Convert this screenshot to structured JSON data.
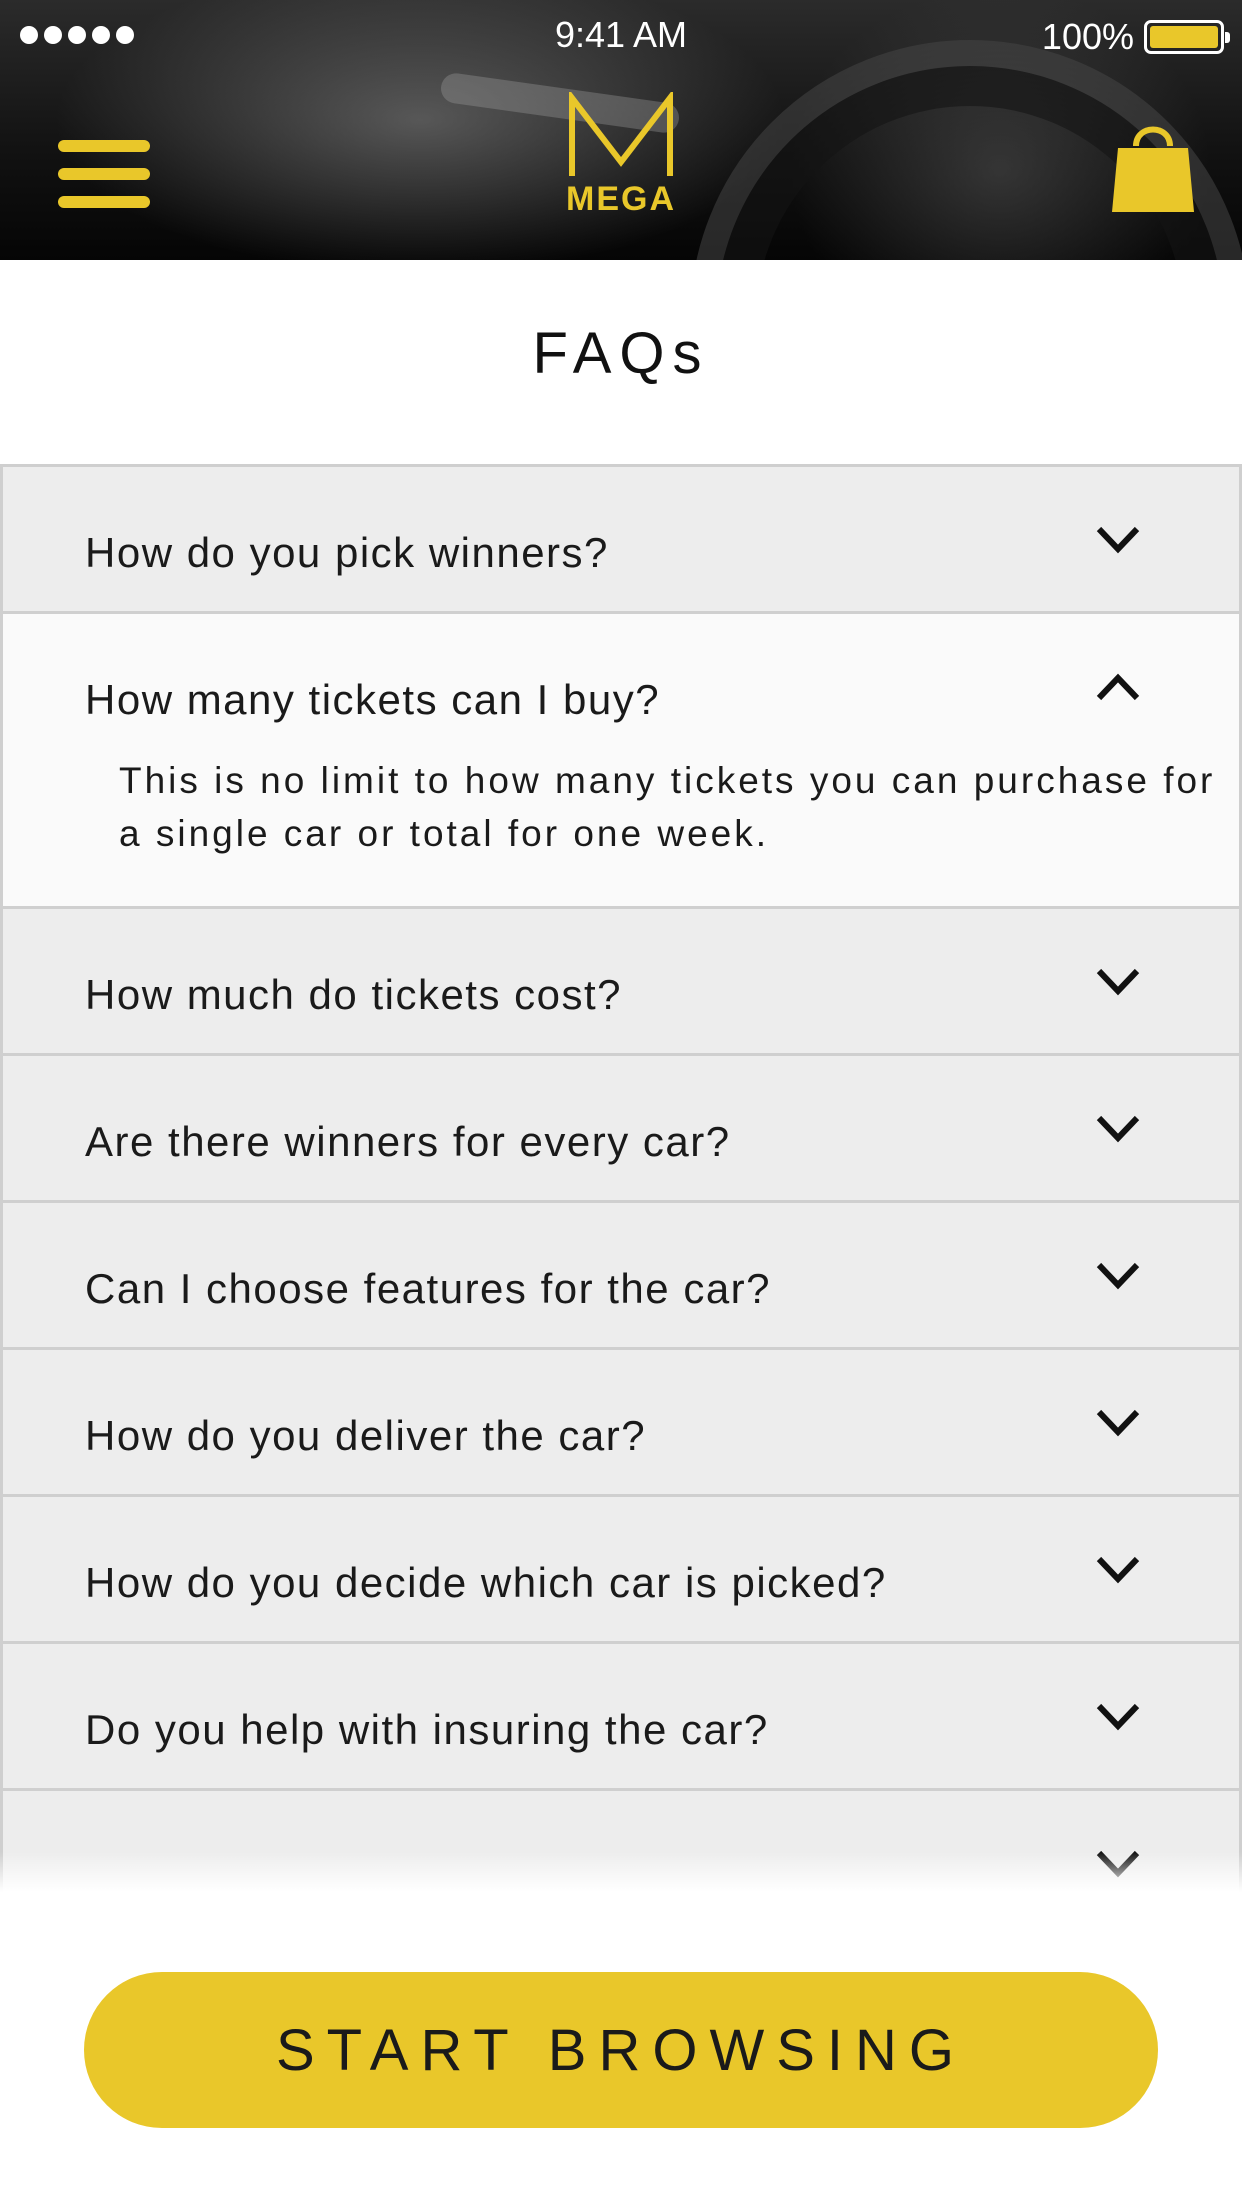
{
  "status_bar": {
    "time": "9:41 AM",
    "battery_percent": "100%",
    "signal_dots": 5
  },
  "header": {
    "logo_letter": "M",
    "logo_text": "MEGA",
    "menu_icon": "hamburger-menu-icon",
    "cart_icon": "shopping-bag-icon",
    "accent_color": "#e9c72a"
  },
  "page": {
    "title": "FAQs"
  },
  "faq": {
    "items": [
      {
        "question": "How do you pick winners?",
        "open": false
      },
      {
        "question": "How many tickets can I buy?",
        "open": true,
        "answer": "This is no limit to how many tickets you can purchase for a single car or total for one week."
      },
      {
        "question": "How much do tickets cost?",
        "open": false
      },
      {
        "question": "Are there winners for every car?",
        "open": false
      },
      {
        "question": "Can I choose features for the car?",
        "open": false
      },
      {
        "question": "How do you deliver the car?",
        "open": false
      },
      {
        "question": "How do you decide which car is picked?",
        "open": false
      },
      {
        "question": "Do you help with insuring the car?",
        "open": false
      },
      {
        "question": "",
        "open": false
      }
    ]
  },
  "cta": {
    "label": "START BROWSING",
    "color": "#e9c72a"
  }
}
